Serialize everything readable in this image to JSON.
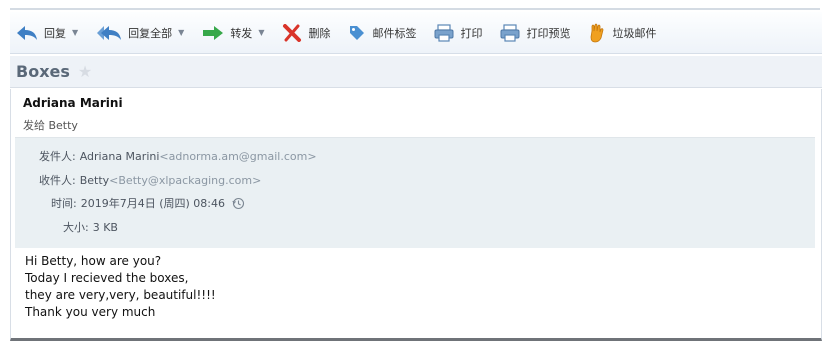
{
  "toolbar": {
    "reply": "回复",
    "reply_all": "回复全部",
    "forward": "转发",
    "delete": "删除",
    "tag": "邮件标签",
    "print": "打印",
    "print_preview": "打印预览",
    "junk": "垃圾邮件",
    "icons": {
      "reply": "reply-arrow-icon",
      "reply_all": "reply-all-arrow-icon",
      "forward": "forward-arrow-icon",
      "delete": "delete-x-icon",
      "tag": "tag-icon",
      "print": "printer-icon",
      "print_preview": "print-preview-icon",
      "junk": "junk-hand-icon"
    }
  },
  "subject": "Boxes",
  "message": {
    "sender_name": "Adriana Marini",
    "sent_to": "发给 Betty",
    "headers": {
      "from_label": "发件人:",
      "from_name": "Adriana Marini",
      "from_email": "<adnorma.am@gmail.com>",
      "to_label": "收件人:",
      "to_name": "Betty",
      "to_email": "<Betty@xlpackaging.com>",
      "date_label": "时间:",
      "date_value": "2019年7月4日 (周四) 08:46",
      "size_label": "大小:",
      "size_value": "3 KB"
    },
    "body": [
      "Hi Betty, how are you?",
      "Today I recieved the boxes,",
      "they are very,very, beautiful!!!!",
      "Thank you very much"
    ]
  },
  "colors": {
    "arrow_blue": "#3f7fc4",
    "forward_green": "#37a84a",
    "delete_red": "#d9342a",
    "header_bg": "#eaf0f3",
    "subject_gray": "#5a6878"
  }
}
